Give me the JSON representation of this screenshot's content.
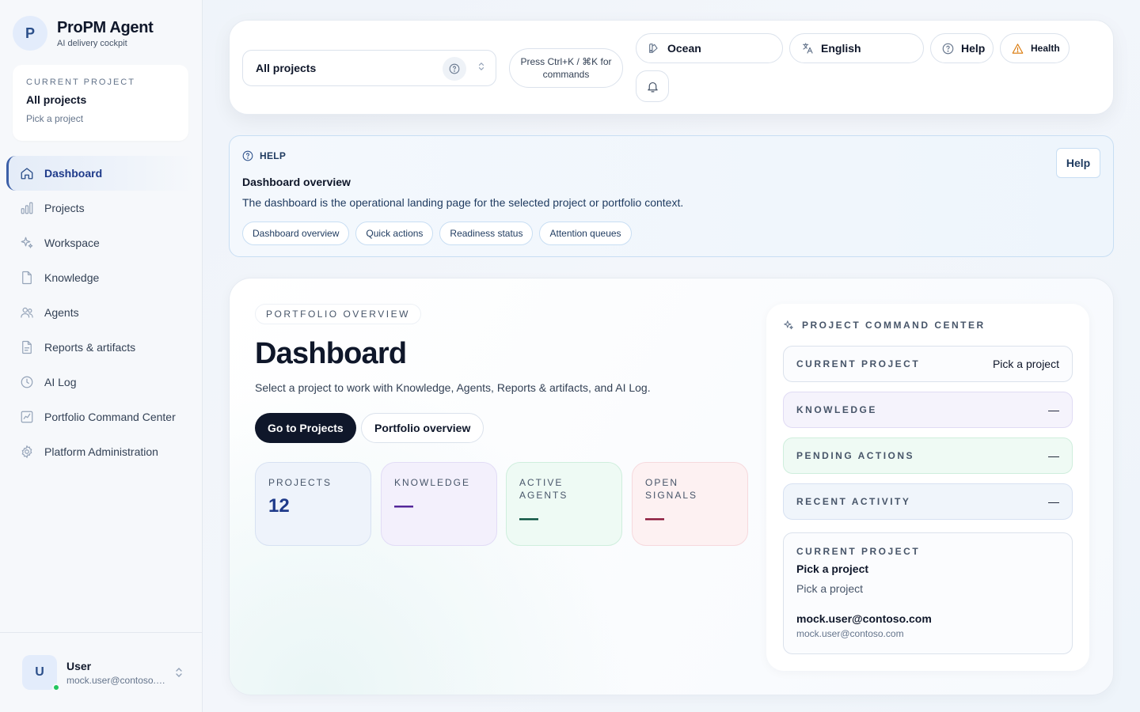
{
  "brand": {
    "initial": "P",
    "name": "ProPM Agent",
    "subtitle": "AI delivery cockpit"
  },
  "sidebar": {
    "current_project": {
      "label": "CURRENT PROJECT",
      "title": "All projects",
      "subtitle": "Pick a project"
    },
    "nav": [
      {
        "label": "Dashboard",
        "icon": "home-icon",
        "active": true
      },
      {
        "label": "Projects",
        "icon": "bar-chart-icon"
      },
      {
        "label": "Workspace",
        "icon": "sparkles-icon"
      },
      {
        "label": "Knowledge",
        "icon": "file-icon"
      },
      {
        "label": "Agents",
        "icon": "users-icon"
      },
      {
        "label": "Reports & artifacts",
        "icon": "file-text-icon"
      },
      {
        "label": "AI Log",
        "icon": "clock-icon"
      },
      {
        "label": "Portfolio Command Center",
        "icon": "chart-line-icon"
      },
      {
        "label": "Platform Administration",
        "icon": "gear-icon"
      }
    ],
    "user": {
      "initial": "U",
      "name": "User",
      "email": "mock.user@contoso.c...",
      "status_color": "#22c55e"
    }
  },
  "topbar": {
    "project_select": {
      "value": "All projects"
    },
    "command_hint": "Press Ctrl+K / ⌘K for commands",
    "theme": "Ocean",
    "language": "English",
    "help": "Help",
    "health": "Health"
  },
  "help_banner": {
    "label": "HELP",
    "title": "Dashboard overview",
    "description": "The dashboard is the operational landing page for the selected project or portfolio context.",
    "chips": [
      "Dashboard overview",
      "Quick actions",
      "Readiness status",
      "Attention queues"
    ],
    "button": "Help"
  },
  "main": {
    "eyebrow": "PORTFOLIO OVERVIEW",
    "title": "Dashboard",
    "description": "Select a project to work with Knowledge, Agents, Reports & artifacts, and AI Log.",
    "primary_button": "Go to Projects",
    "secondary_button": "Portfolio overview",
    "stats": {
      "projects": {
        "label": "PROJECTS",
        "value": "12"
      },
      "knowledge": {
        "label": "KNOWLEDGE",
        "value": "—"
      },
      "agents": {
        "label": "ACTIVE AGENTS",
        "value": "—"
      },
      "signals": {
        "label": "OPEN SIGNALS",
        "value": "—"
      }
    }
  },
  "command_center": {
    "title": "PROJECT COMMAND CENTER",
    "rows": {
      "current_project": {
        "label": "CURRENT PROJECT",
        "value": "Pick a project"
      },
      "knowledge": {
        "label": "KNOWLEDGE",
        "value": "—"
      },
      "pending_actions": {
        "label": "PENDING ACTIONS",
        "value": "—"
      },
      "recent_activity": {
        "label": "RECENT ACTIVITY",
        "value": "—"
      }
    },
    "card": {
      "label": "CURRENT PROJECT",
      "title": "Pick a project",
      "subtitle": "Pick a project",
      "email": "mock.user@contoso.com",
      "email_sub": "mock.user@contoso.com"
    }
  },
  "colors": {
    "accent": "#2b4f8a",
    "primary_button": "#0f172a",
    "online": "#22c55e"
  }
}
